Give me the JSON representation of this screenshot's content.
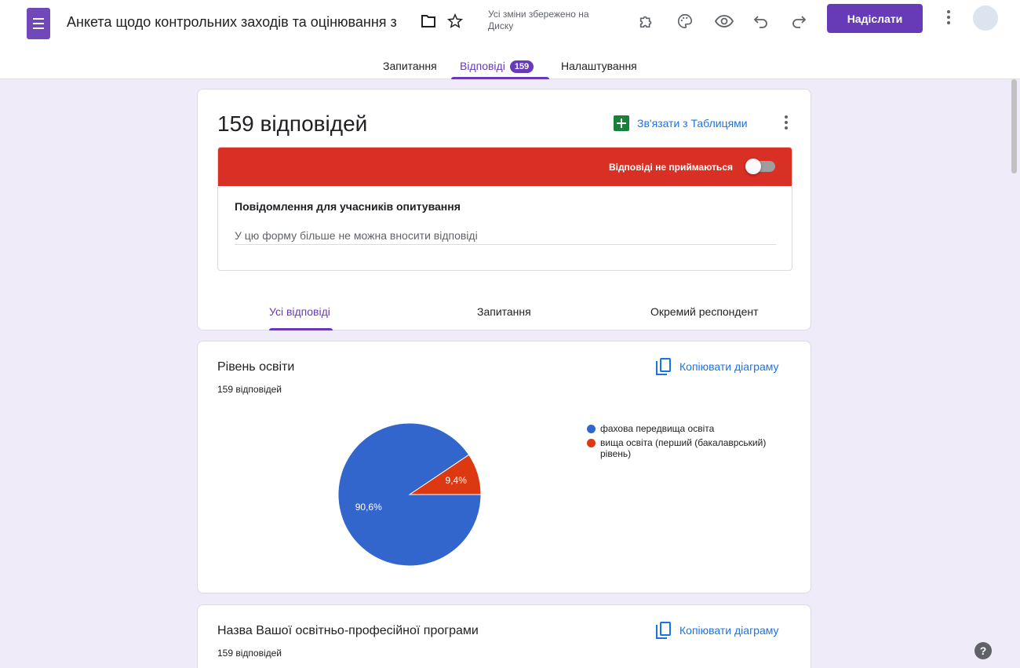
{
  "header": {
    "form_title": "Анкета щодо контрольних заходів та  оцінювання з",
    "save_status": "Усі зміни збережено на Диску",
    "send_label": "Надіслати",
    "icons": [
      "forms-logo-icon",
      "folder-icon",
      "star-icon",
      "addon-puzzle-icon",
      "palette-icon",
      "preview-eye-icon",
      "undo-icon",
      "redo-icon",
      "more-vert-icon",
      "avatar"
    ]
  },
  "tabs": {
    "questions": "Запитання",
    "responses": "Відповіді",
    "responses_badge": "159",
    "settings": "Налаштування"
  },
  "summary": {
    "title": "159 відповідей",
    "link_sheets": "Зв'язати з Таблицями",
    "not_accepting": "Відповіді не приймаються",
    "accepting_responses": false,
    "message_heading": "Повідомлення для учасників опитування",
    "message_text": "У цю форму більше не можна вносити відповіді",
    "subtabs": {
      "all": "Усі відповіді",
      "questions": "Запитання",
      "individual": "Окремий респондент"
    }
  },
  "questions": [
    {
      "title": "Рівень освіти",
      "count": "159 відповідей",
      "copy_label": "Копіювати діаграму"
    },
    {
      "title": "Назва Вашої освітньо-професійної програми",
      "count": "159 відповідей",
      "copy_label": "Копіювати діаграму"
    }
  ],
  "chart_data": {
    "type": "pie",
    "series": [
      {
        "name": "фахова передвища освіта",
        "value": 90.6,
        "label": "90,6%",
        "color": "#3366cc"
      },
      {
        "name": "вища освіта (перший (бакалаврський) рівень)",
        "value": 9.4,
        "label": "9,4%",
        "color": "#dc3912"
      }
    ]
  },
  "colors": {
    "accent": "#673ab7",
    "banner_red": "#d93025",
    "link_blue": "#1a73e8",
    "page_bg": "#f0ebf8"
  },
  "help_label": "?"
}
